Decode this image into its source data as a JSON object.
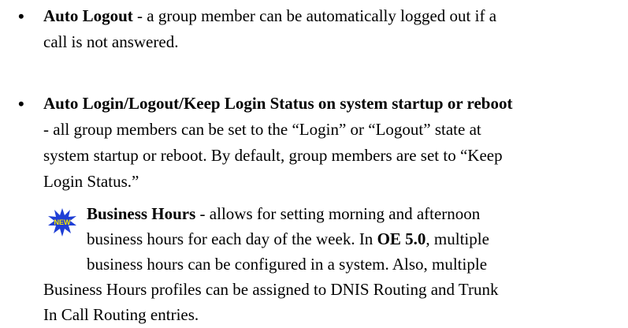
{
  "bullets": [
    {
      "marker": "•",
      "term": "Auto Logout",
      "lines": [
        " - a group member can be automatically logged out if a",
        "call is not answered."
      ]
    },
    {
      "marker": "•",
      "term": "Auto Login/Logout/Keep Login Status on system startup or reboot",
      "lines": [
        "- all group members can be set to the “Login” or “Logout” state at",
        "system startup or reboot. By default, group members are set to “Keep",
        "Login Status.”"
      ]
    }
  ],
  "new_feature": {
    "badge_label": "NEW",
    "term": "Business Hours",
    "line1_rest": " - allows for setting morning and afternoon",
    "line2": "business hours for each day of the week. In ",
    "line2_bold": "OE 5.0",
    "line2_end": ", multiple",
    "line3": "business hours can be configured in a system. Also, multiple",
    "line4": "Business Hours profiles can be assigned to DNIS Routing and Trunk",
    "line5": "In Call Routing entries."
  },
  "colors": {
    "text": "#000000",
    "badge_star": "#1f3fd6",
    "badge_text": "#f5e600"
  }
}
